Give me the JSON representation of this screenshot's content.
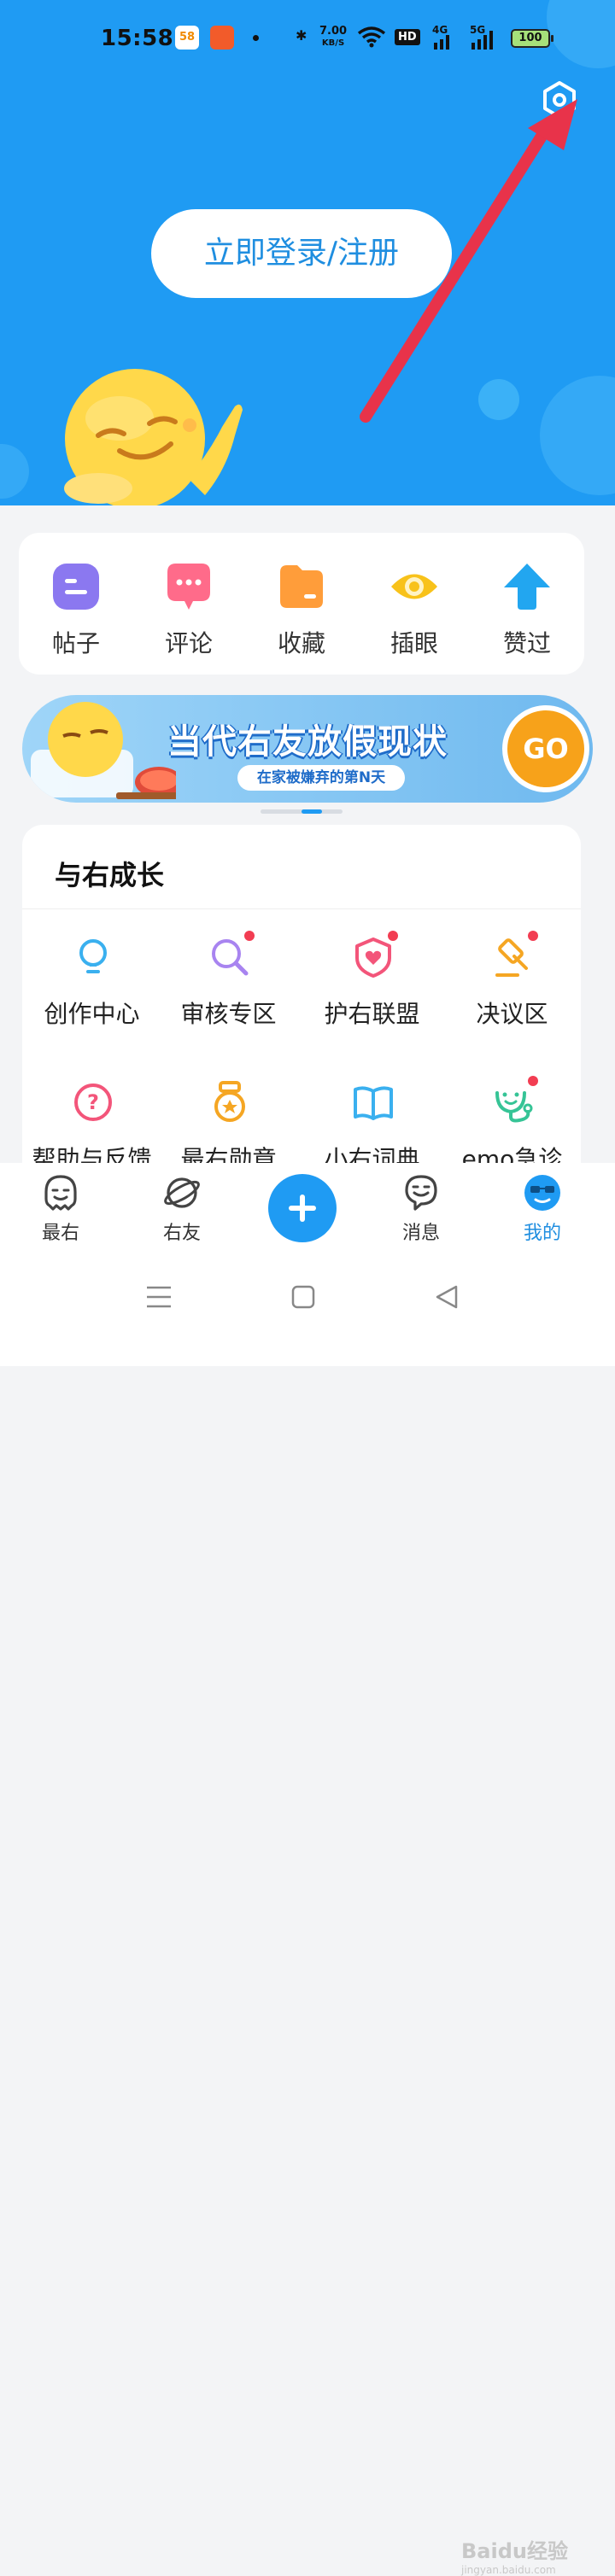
{
  "status_bar": {
    "time": "15:58",
    "app1_label": "58",
    "net_speed_value": "7.00",
    "net_speed_unit": "KB/S",
    "hd_label": "HD",
    "sig1_label": "4G",
    "sig2_label": "5G",
    "battery": "100"
  },
  "header": {
    "login_label": "立即登录/注册",
    "settings_icon": "settings-hex-icon"
  },
  "quick_actions": [
    {
      "label": "帖子",
      "icon": "posts-icon",
      "color": "#8b78f0"
    },
    {
      "label": "评论",
      "icon": "comments-icon",
      "color": "#ff6b8a"
    },
    {
      "label": "收藏",
      "icon": "favorites-folder-icon",
      "color": "#ff9d3a"
    },
    {
      "label": "插眼",
      "icon": "eye-icon",
      "color": "#f8c21a"
    },
    {
      "label": "赞过",
      "icon": "upvote-arrow-icon",
      "color": "#22a6f0"
    }
  ],
  "banner": {
    "title": "当代右友放假现状",
    "subtitle": "在家被嫌弃的第N天",
    "go_label": "GO"
  },
  "growth": {
    "title": "与右成长",
    "items": [
      {
        "label": "创作中心",
        "icon": "lightbulb-icon",
        "red_dot": false
      },
      {
        "label": "审核专区",
        "icon": "magnifier-icon",
        "red_dot": true
      },
      {
        "label": "护右联盟",
        "icon": "shield-heart-icon",
        "red_dot": true
      },
      {
        "label": "决议区",
        "icon": "gavel-icon",
        "red_dot": true
      },
      {
        "label": "帮助与反馈",
        "icon": "help-icon",
        "red_dot": false
      },
      {
        "label": "最右勋章",
        "icon": "medal-icon",
        "red_dot": false
      },
      {
        "label": "小右词典",
        "icon": "book-icon",
        "red_dot": false
      },
      {
        "label": "emo急诊",
        "icon": "stethoscope-icon",
        "red_dot": true
      }
    ]
  },
  "tabbar": {
    "tabs": [
      {
        "label": "最右",
        "icon": "home-face-icon",
        "active": false
      },
      {
        "label": "右友",
        "icon": "planet-icon",
        "active": false
      },
      {
        "label": "消息",
        "icon": "message-face-icon",
        "active": false
      },
      {
        "label": "我的",
        "icon": "profile-face-icon",
        "active": true
      }
    ],
    "publish_icon": "plus-icon"
  },
  "watermark": {
    "text": "Baidu经验",
    "url_text": "jingyan.baidu.com"
  }
}
